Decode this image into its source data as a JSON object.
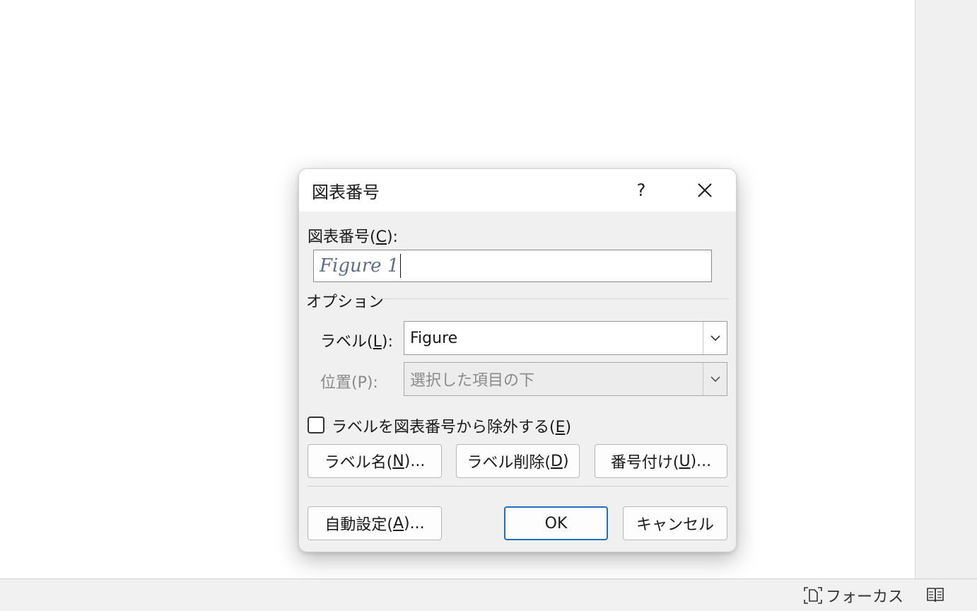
{
  "dialog": {
    "title": "図表番号",
    "help_label": "?",
    "caption_label_prefix": "図表番号(",
    "caption_label_key": "C",
    "caption_label_suffix": "):",
    "caption_value": "Figure 1",
    "options_group_label": "オプション",
    "label_field": {
      "prefix": "ラベル(",
      "key": "L",
      "suffix": "):",
      "value": "Figure"
    },
    "position_field": {
      "label": "位置(P):",
      "value": "選択した項目の下"
    },
    "exclude_checkbox": {
      "prefix": "ラベルを図表番号から除外する(",
      "key": "E",
      "suffix": ")",
      "checked": false
    },
    "buttons": {
      "new_label": {
        "prefix": "ラベル名(",
        "key": "N",
        "suffix": ")..."
      },
      "delete_label": {
        "prefix": "ラベル削除(",
        "key": "D",
        "suffix": ")"
      },
      "numbering": {
        "prefix": "番号付け(",
        "key": "U",
        "suffix": ")..."
      },
      "autocaption": {
        "prefix": "自動設定(",
        "key": "A",
        "suffix": ")..."
      },
      "ok": "OK",
      "cancel": "キャンセル"
    }
  },
  "status_bar": {
    "focus_label": "フォーカス"
  },
  "colors": {
    "primary_border": "#1f6fbf",
    "dialog_bg": "#f0f0f0"
  }
}
